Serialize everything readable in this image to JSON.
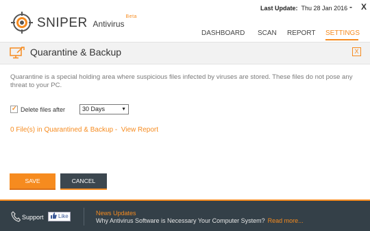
{
  "app": {
    "name": "SNIPER",
    "subtitle": "Antivirus",
    "badge": "Beta",
    "accent_color": "#f68b1f",
    "footer_color": "#344048"
  },
  "header": {
    "last_update_label": "Last Update:",
    "last_update_value": "Thu 28 Jan 2016",
    "minimize_label": "-",
    "close_label": "X",
    "nav": [
      {
        "label": "DASHBOARD",
        "active": false
      },
      {
        "label": "SCAN",
        "active": false
      },
      {
        "label": "REPORT",
        "active": false
      },
      {
        "label": "SETTINGS",
        "active": true
      }
    ]
  },
  "panel": {
    "title": "Quarantine & Backup",
    "icon": "monitor-wrench-icon",
    "close_label": "X",
    "description": "Quarantine is a special holding area where suspicious files infected by viruses are stored. These files do not pose any threat to your PC.",
    "delete_option": {
      "label": "Delete files after",
      "checked": true,
      "selected_value": "30 Days"
    },
    "report_line": {
      "text": "0 File(s) in Quarantined & Backup -",
      "link_label": "View Report"
    }
  },
  "buttons": {
    "save_label": "SAVE",
    "cancel_label": "CANCEL"
  },
  "footer": {
    "support_label": "Support",
    "like_label": "Like",
    "news_title": "News Updates",
    "news_text": "Why Antivirus Software is Necessary Your Computer System?",
    "news_more": "Read more..."
  }
}
